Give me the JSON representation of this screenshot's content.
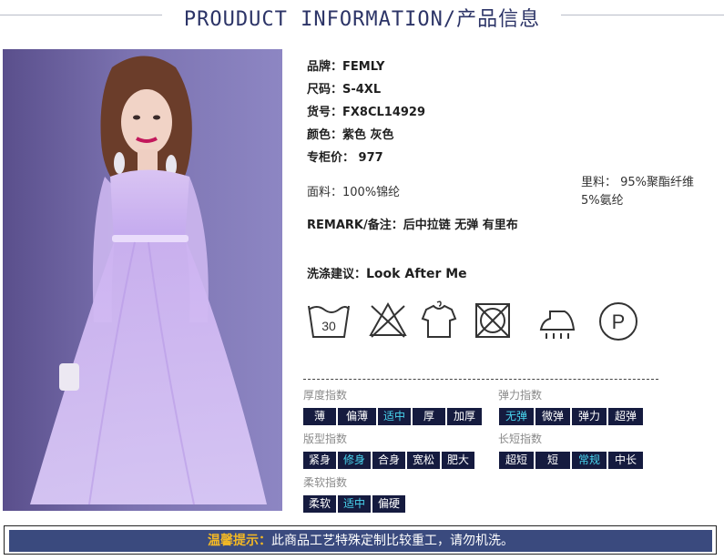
{
  "header": {
    "title": "PROUDUCT INFORMATION/产品信息"
  },
  "product": {
    "brand": "品牌：FEMLY",
    "size": "尺码：S-4XL",
    "item_no": "货号：FX8CL14929",
    "color": "颜色：紫色 灰色",
    "price": "专柜价： 977",
    "fabric": "面料：100%锦纶",
    "lining_line1": "里料： 95%聚酯纤维",
    "lining_line2": "5%氨纶",
    "remark": "REMARK/备注：后中拉链 无弹 有里布",
    "wash_prefix": "洗涤建议：",
    "wash_value": "Look After Me"
  },
  "care_icons": [
    {
      "name": "wash-30-icon",
      "text": "30"
    },
    {
      "name": "no-bleach-icon",
      "text": ""
    },
    {
      "name": "tumble-dry-icon",
      "text": ""
    },
    {
      "name": "no-tumble-dry-icon",
      "text": ""
    },
    {
      "name": "iron-icon",
      "text": ""
    },
    {
      "name": "dry-clean-p-icon",
      "text": "P"
    }
  ],
  "indices": {
    "thickness": {
      "label": "厚度指数",
      "options": [
        "薄",
        "偏薄",
        "适中",
        "厚",
        "加厚"
      ],
      "selected": 2
    },
    "elasticity": {
      "label": "弹力指数",
      "options": [
        "无弹",
        "微弹",
        "弹力",
        "超弹"
      ],
      "selected": 0
    },
    "fit": {
      "label": "版型指数",
      "options": [
        "紧身",
        "修身",
        "合身",
        "宽松",
        "肥大"
      ],
      "selected": 1
    },
    "length": {
      "label": "长短指数",
      "options": [
        "超短",
        "短",
        "常规",
        "中长"
      ],
      "selected": 2
    },
    "softness": {
      "label": "柔软指数",
      "options": [
        "柔软",
        "适中",
        "偏硬"
      ],
      "selected": 1
    }
  },
  "footer": {
    "highlight": "温馨提示：",
    "text": "此商品工艺特殊定制比较重工，请勿机洗。"
  },
  "colors": {
    "navy": "#151b3f",
    "selected_text": "#49d6f0",
    "footer_bg": "#3a4a7e",
    "footer_highlight": "#f2b825"
  }
}
